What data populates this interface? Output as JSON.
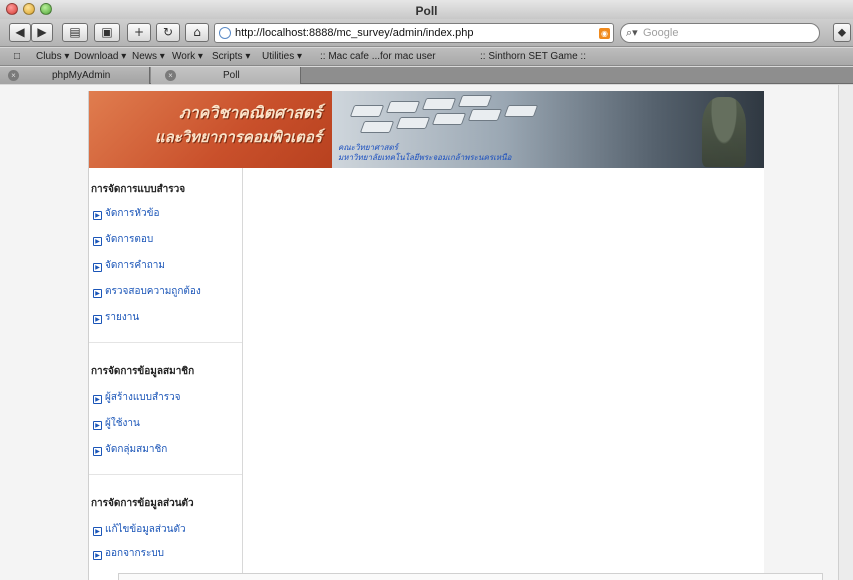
{
  "window": {
    "title": "Poll"
  },
  "toolbar": {
    "url": "http://localhost:8888/mc_survey/admin/index.php",
    "search_placeholder": "Google"
  },
  "bookmarks": [
    "Clubs ▾",
    "Download ▾",
    "News ▾",
    "Work ▾",
    "Scripts ▾",
    "Utilities ▾",
    "Mac cafe ...for mac user",
    "Sinthorn SET Game"
  ],
  "tabs": [
    {
      "label": "phpMyAdmin"
    },
    {
      "label": "Poll"
    }
  ],
  "banner": {
    "line1": "ภาควิชาคณิตศาสตร์",
    "line2": "และวิทยาการคอมพิวเตอร์",
    "caption1": "คณะวิทยาศาสตร์",
    "caption2": "มหาวิทยาลัยเทคโนโลยีพระจอมเกล้าพระนครเหนือ"
  },
  "sidebar": {
    "sections": [
      {
        "title": "การจัดการแบบสำรวจ",
        "items": [
          "จัดการหัวข้อ",
          "จัดการตอบ",
          "จัดการคำถาม",
          "ตรวจสอบความถูกต้อง",
          "รายงาน"
        ]
      },
      {
        "title": "การจัดการข้อมูลสมาชิก",
        "items": [
          "ผู้สร้างแบบสำรวจ",
          "ผู้ใช้งาน",
          "จัดกลุ่มสมาชิก"
        ]
      },
      {
        "title": "การจัดการข้อมูลส่วนตัว",
        "items": [
          "แก้ไขข้อมูลส่วนตัว",
          "ออกจากระบบ"
        ]
      }
    ]
  }
}
